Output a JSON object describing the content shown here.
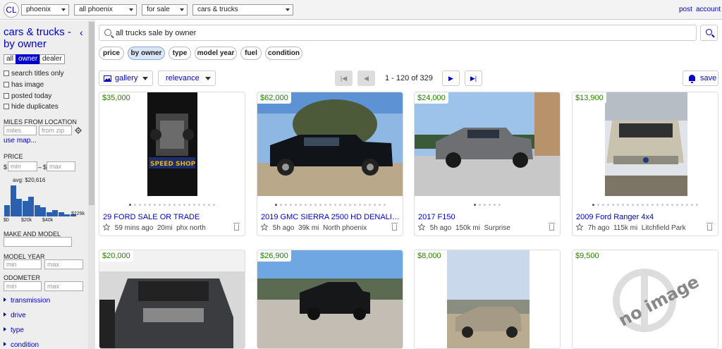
{
  "topbar": {
    "logo": "CL",
    "area": "phoenix",
    "subarea": "all phoenix",
    "section": "for sale",
    "category": "cars & trucks",
    "post": "post",
    "account": "account"
  },
  "sidebar": {
    "title": "cars & trucks - by owner",
    "collapse": "‹",
    "seller": {
      "all": "all",
      "owner": "owner",
      "dealer": "dealer"
    },
    "checks": [
      "search titles only",
      "has image",
      "posted today",
      "hide duplicates"
    ],
    "miles_label": "MILES FROM LOCATION",
    "miles_ph": "miles",
    "zip_ph": "from zip",
    "use_map": "use map...",
    "price_label": "PRICE",
    "price_cur": "$",
    "price_dash": "–",
    "min_ph": "min",
    "max_ph": "max",
    "avg": "avg: $20,616",
    "hist_values": [
      5,
      14,
      8,
      7,
      9,
      5,
      4,
      2,
      3,
      2,
      1,
      1
    ],
    "hist_ticks": [
      "$0",
      "$20k",
      "$40k",
      "$229k"
    ],
    "make_model_label": "MAKE AND MODEL",
    "model_year_label": "MODEL YEAR",
    "odometer_label": "ODOMETER",
    "facets": [
      "transmission",
      "drive",
      "type",
      "condition"
    ]
  },
  "search": {
    "query": "all trucks sale by owner"
  },
  "chips": [
    "price",
    "by owner",
    "type",
    "model year",
    "fuel",
    "condition"
  ],
  "toolbar": {
    "view": "gallery",
    "sort": "relevance",
    "page_text": "1 - 120 of 329",
    "save": "save"
  },
  "listings": [
    {
      "price": "$35,000",
      "title": "29 FORD SALE OR TRADE",
      "age": "59 mins ago",
      "miles": "20mi",
      "loc": "phx north",
      "dots": 18,
      "on": 0
    },
    {
      "price": "$62,000",
      "title": "2019 GMC SIERRA 2500 HD DENALI ...",
      "age": "5h ago",
      "miles": "39k mi",
      "loc": "North phoenix",
      "dots": 23,
      "on": 0
    },
    {
      "price": "$24,000",
      "title": "2017 F150",
      "age": "5h ago",
      "miles": "150k mi",
      "loc": "Surprise",
      "dots": 6,
      "on": 0
    },
    {
      "price": "$13,900",
      "title": "2009 Ford Ranger 4x4",
      "age": "7h ago",
      "miles": "115k mi",
      "loc": "Litchfield Park",
      "dots": 22,
      "on": 0
    },
    {
      "price": "$20,000"
    },
    {
      "price": "$26,900"
    },
    {
      "price": "$8,000"
    },
    {
      "price": "$9,500",
      "noimage": "no image"
    }
  ],
  "colors": {
    "link": "#0000cc",
    "price": "#2a8000",
    "active_seg": "#0000cc"
  }
}
